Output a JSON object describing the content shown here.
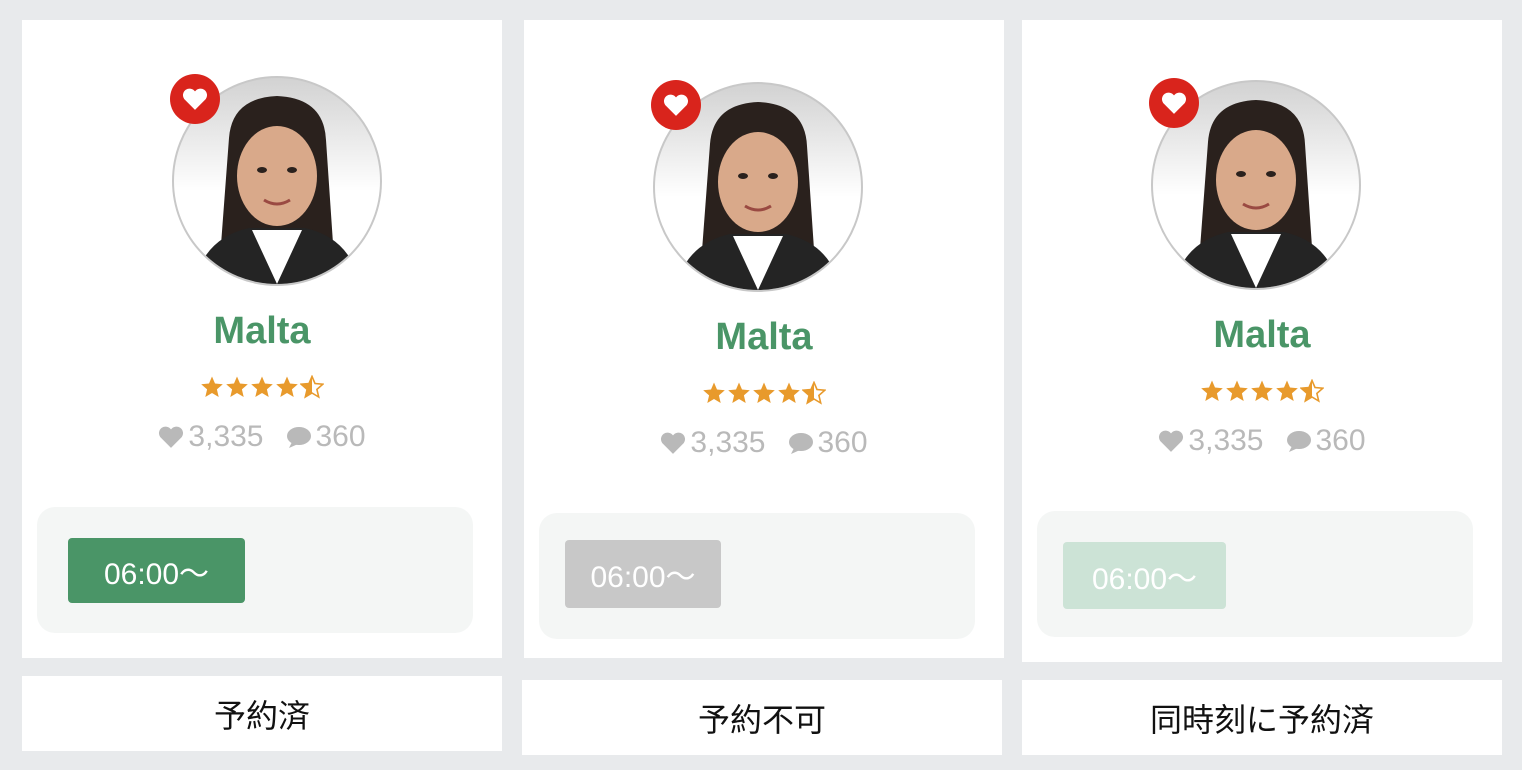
{
  "cards": [
    {
      "name": "Malta",
      "rating": 4.5,
      "likes": "3,335",
      "reviews": "360",
      "slot_label": "06:00〜",
      "slot_state": "booked",
      "status_text": "予約済"
    },
    {
      "name": "Malta",
      "rating": 4.5,
      "likes": "3,335",
      "reviews": "360",
      "slot_label": "06:00〜",
      "slot_state": "unavailable",
      "status_text": "予約不可"
    },
    {
      "name": "Malta",
      "rating": 4.5,
      "likes": "3,335",
      "reviews": "360",
      "slot_label": "06:00〜",
      "slot_state": "booked-same-time",
      "status_text": "同時刻に予約済"
    }
  ],
  "icons": {
    "favorite": "heart-icon",
    "likes": "heart-icon",
    "reviews": "speech-bubble-icon",
    "rating": "star-icon"
  },
  "colors": {
    "name_green": "#4a9567",
    "slot_booked": "#4a9567",
    "slot_unavailable": "#c8c8c8",
    "slot_same_time": "#cce3d6",
    "star": "#e89a2c",
    "favorite_red": "#d9241c",
    "muted_gray": "#b9b9b9"
  }
}
